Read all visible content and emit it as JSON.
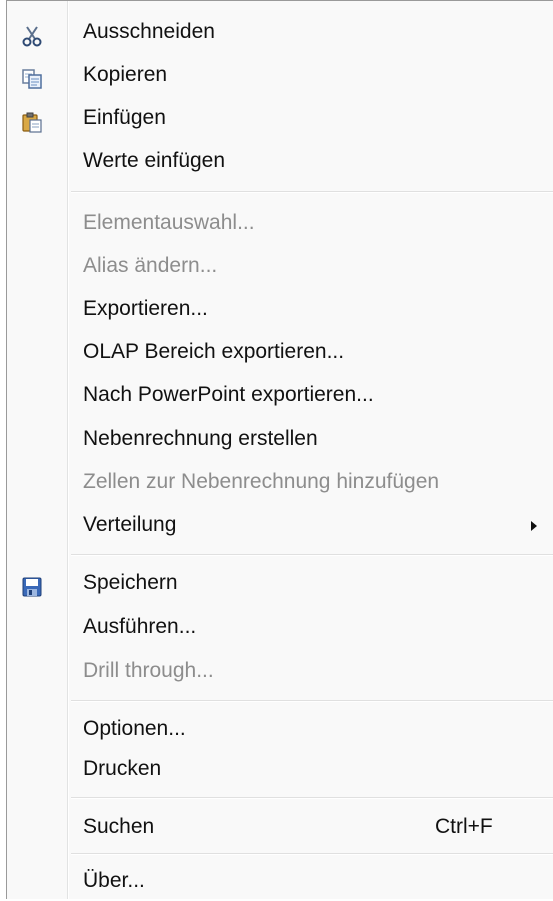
{
  "menu": {
    "items": [
      {
        "label": "Ausschneiden",
        "icon": "scissors-icon",
        "disabled": false
      },
      {
        "label": "Kopieren",
        "icon": "copy-icon",
        "disabled": false
      },
      {
        "label": "Einfügen",
        "icon": "paste-icon",
        "disabled": false
      },
      {
        "label": "Werte einfügen",
        "disabled": false
      },
      {
        "label": "Elementauswahl...",
        "disabled": true
      },
      {
        "label": "Alias ändern...",
        "disabled": true
      },
      {
        "label": "Exportieren...",
        "disabled": false
      },
      {
        "label": "OLAP Bereich exportieren...",
        "disabled": false
      },
      {
        "label": "Nach PowerPoint exportieren...",
        "disabled": false
      },
      {
        "label": "Nebenrechnung erstellen",
        "disabled": false
      },
      {
        "label": "Zellen zur Nebenrechnung hinzufügen",
        "disabled": true
      },
      {
        "label": "Verteilung",
        "disabled": false,
        "submenu": true
      },
      {
        "label": "Speichern",
        "icon": "save-icon",
        "disabled": false
      },
      {
        "label": "Ausführen...",
        "disabled": false
      },
      {
        "label": "Drill through...",
        "disabled": true
      },
      {
        "label": "Optionen...",
        "disabled": false
      },
      {
        "label": "Drucken",
        "disabled": false
      },
      {
        "label": "Suchen",
        "shortcut": "Ctrl+F",
        "disabled": false
      },
      {
        "label": "Über...",
        "disabled": false
      }
    ]
  },
  "colors": {
    "menu_background": "#f9f9f9",
    "enabled_text": "#111111",
    "disabled_text": "#8d8d8d"
  }
}
